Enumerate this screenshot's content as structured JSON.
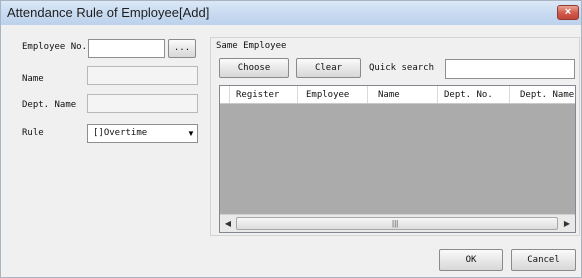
{
  "window": {
    "title": "Attendance Rule of Employee[Add]",
    "close_label": "×"
  },
  "form": {
    "employee_no_label": "Employee No.",
    "employee_no_value": "",
    "browse_label": "...",
    "name_label": "Name",
    "name_value": "",
    "dept_name_label": "Dept. Name",
    "dept_name_value": "",
    "rule_label": "Rule",
    "rule_selected": "[]Overtime"
  },
  "same_employee": {
    "group_label": "Same Employee",
    "choose_label": "Choose",
    "clear_label": "Clear",
    "quick_search_label": "Quick search",
    "quick_search_value": "",
    "columns": [
      "Register",
      "Employee",
      "Name",
      "Dept. No.",
      "Dept. Name"
    ],
    "rows": [],
    "scroll_left": "◀",
    "scroll_right": "▶",
    "scroll_grip": "|||"
  },
  "footer": {
    "ok_label": "OK",
    "cancel_label": "Cancel"
  },
  "icons": {
    "combo_arrow": "triangle-down-icon"
  }
}
